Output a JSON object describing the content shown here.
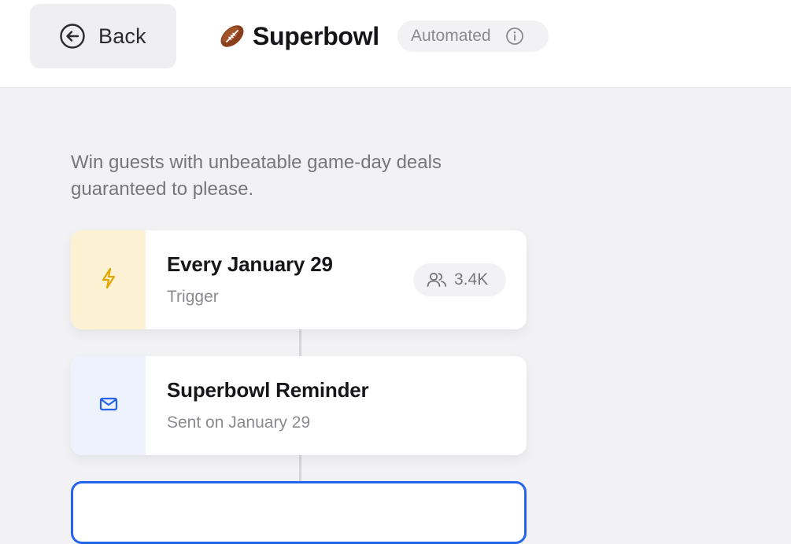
{
  "header": {
    "back_label": "Back",
    "title": "Superbowl",
    "status_label": "Automated"
  },
  "description": "Win guests with unbeatable game-day deals guaranteed to please.",
  "steps": [
    {
      "title": "Every January 29",
      "subtitle": "Trigger",
      "icon": "lightning-icon",
      "icon_bg": "#fdf1d3",
      "icon_color": "#e0a800",
      "audience_count": "3.4K"
    },
    {
      "title": "Superbowl Reminder",
      "subtitle": "Sent on January 29",
      "icon": "envelope-icon",
      "icon_bg": "#eef2fd",
      "icon_color": "#2563eb"
    }
  ],
  "colors": {
    "accent": "#2563eb",
    "page_bg": "#f2f1f4"
  }
}
